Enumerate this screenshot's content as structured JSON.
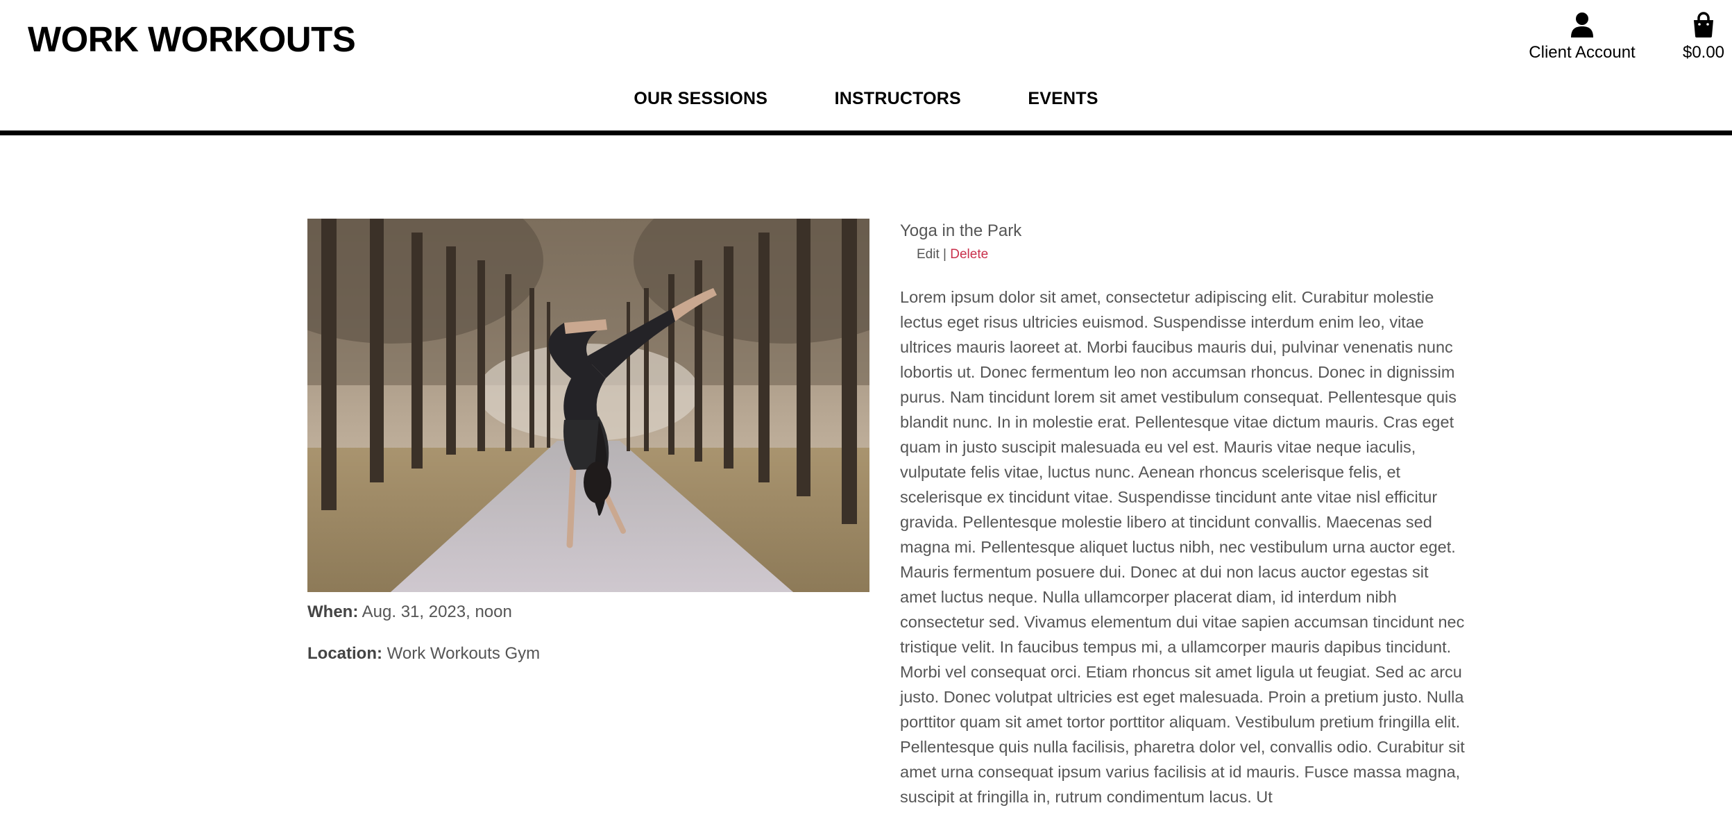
{
  "header": {
    "brand": "WORK WORKOUTS",
    "account": {
      "label": "Client Account",
      "icon": "user-icon"
    },
    "bag": {
      "total": "$0.00",
      "icon": "shopping-bag-icon"
    },
    "nav": [
      {
        "label": "OUR SESSIONS"
      },
      {
        "label": "INSTRUCTORS"
      },
      {
        "label": "EVENTS"
      }
    ]
  },
  "event": {
    "title": "Yoga in the Park",
    "edit_label": "Edit",
    "separator": "|",
    "delete_label": "Delete",
    "when_label": "When:",
    "when_value": "Aug. 31, 2023, noon",
    "location_label": "Location:",
    "location_value": "Work Workouts Gym",
    "description": "Lorem ipsum dolor sit amet, consectetur adipiscing elit. Curabitur molestie lectus eget risus ultricies euismod. Suspendisse interdum enim leo, vitae ultrices mauris laoreet at. Morbi faucibus mauris dui, pulvinar venenatis nunc lobortis ut. Donec fermentum leo non accumsan rhoncus. Donec in dignissim purus. Nam tincidunt lorem sit amet vestibulum consequat. Pellentesque quis blandit nunc. In in molestie erat. Pellentesque vitae dictum mauris. Cras eget quam in justo suscipit malesuada eu vel est. Mauris vitae neque iaculis, vulputate felis vitae, luctus nunc. Aenean rhoncus scelerisque felis, et scelerisque ex tincidunt vitae. Suspendisse tincidunt ante vitae nisl efficitur gravida. Pellentesque molestie libero at tincidunt convallis. Maecenas sed magna mi. Pellentesque aliquet luctus nibh, nec vestibulum urna auctor eget. Mauris fermentum posuere dui. Donec at dui non lacus auctor egestas sit amet luctus neque. Nulla ullamcorper placerat diam, id interdum nibh consectetur sed. Vivamus elementum dui vitae sapien accumsan tincidunt nec tristique velit. In faucibus tempus mi, a ullamcorper mauris dapibus tincidunt. Morbi vel consequat orci. Etiam rhoncus sit amet ligula ut feugiat. Sed ac arcu justo. Donec volutpat ultricies est eget malesuada. Proin a pretium justo. Nulla porttitor quam sit amet tortor porttitor aliquam. Vestibulum pretium fringilla elit. Pellentesque quis nulla facilisis, pharetra dolor vel, convallis odio. Curabitur sit amet urna consequat ipsum varius facilisis at id mauris. Fusce massa magna, suscipit at fringilla in, rutrum condimentum lacus. Ut"
  },
  "colors": {
    "accent_delete": "#c9304b",
    "text": "#555555",
    "brand": "#000000"
  }
}
